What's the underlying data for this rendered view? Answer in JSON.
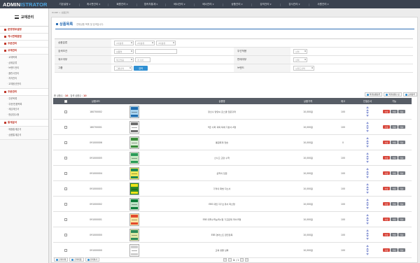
{
  "app": {
    "logo_part1": "ADMIN",
    "logo_part2": "ISTRATOR"
  },
  "top_menu": [
    "기본설정",
    "게시판관리",
    "회원관리",
    "접속자통계",
    "배너관리",
    "배너관리",
    "상품관리",
    "강의관리",
    "강사관리",
    "사원관리"
  ],
  "sidebar": {
    "title": "교재관리",
    "groups": [
      {
        "label": "운영정보설정",
        "items": []
      },
      {
        "label": "게시판제출점",
        "items": []
      },
      {
        "label": "주문관리",
        "items": []
      },
      {
        "label": "교재관리",
        "items": [
          "교재목록",
          "상위분류",
          "브랜드관리",
          "출판사관리",
          "저자관리",
          "교재옵션관리"
        ]
      },
      {
        "label": "주문관리",
        "items": [
          "주문목록",
          "주문/반품목록",
          "세금계산서",
          "현금영수증"
        ]
      },
      {
        "label": "통계분석",
        "items": [
          "매출통계분석",
          "상품통계분석"
        ]
      }
    ]
  },
  "breadcrumb": "HOME > 상품관리",
  "page": {
    "title": "상품목록",
    "description": "전체상품 목록 및 검색입니다."
  },
  "form": {
    "category_label": "상품분류",
    "category_selects": [
      "1차분류",
      "2차분류",
      "3차분류"
    ],
    "search_label": "검색조건",
    "search_select": "상품명",
    "sort_label": "우선적용",
    "sort_select": "선택",
    "display_label": "재고여부",
    "display_select": "재고있음",
    "display_input": "개 이하",
    "sale_label": "판매여부",
    "sale_select": "선택",
    "group_label": "그룹",
    "group_select": "그룹선택",
    "search_button": "검색",
    "brand_label": "브랜드",
    "brand_select": "브랜드선택"
  },
  "list": {
    "total_label": "총 상품수 :",
    "total_value": "10",
    "search_label": ", 검색 상품수 :",
    "search_value": "10",
    "tools": [
      "엑셀상품등록",
      "엑셀상품수정",
      "교재등록"
    ]
  },
  "table": {
    "headers": [
      "상품코드",
      "상품명",
      "상품가격",
      "재고",
      "진열순서",
      "기능"
    ],
    "actions": [
      "수정",
      "삭제",
      "복사"
    ],
    "rows": [
      {
        "code": "180700002",
        "name": "정선수 영양씨 로스쿨 입문강좌",
        "price": "10,000원",
        "stock": "100",
        "colors": [
          "#1f6cae",
          "#a7d3ef"
        ]
      },
      {
        "code": "180700001",
        "name": "9급 사회 과목 독해 기본서 A형",
        "price": "10,000원",
        "stock": "100",
        "colors": [
          "#6e6e6e",
          "#ffffff"
        ]
      },
      {
        "code": "091000006",
        "name": "통합회계 연습",
        "price": "10,000원",
        "stock": "0",
        "colors": [
          "#3a8c3a",
          "#d8ecd4"
        ]
      },
      {
        "code": "091000005",
        "name": "신사고 교양 수학",
        "price": "10,000원",
        "stock": "100",
        "colors": [
          "#2a9a58",
          "#c6e9c2"
        ]
      },
      {
        "code": "091000004",
        "name": "공학의 입문",
        "price": "10,000원",
        "stock": "100",
        "colors": [
          "#1d8a55",
          "#f2e95a"
        ]
      },
      {
        "code": "091000003",
        "name": "기적의 화법 자소서",
        "price": "10,000원",
        "stock": "100",
        "colors": [
          "#f0e21a",
          "#2b8a2b"
        ]
      },
      {
        "code": "091000002",
        "name": "EBS 대입 자기소개서 최신형",
        "price": "10,000원",
        "stock": "100",
        "colors": [
          "#0e7d3a",
          "#bde3c6"
        ]
      },
      {
        "code": "091000001",
        "name": "EBS 대학수학능력시험 기출문제 국어 B형",
        "price": "10,000원",
        "stock": "100",
        "colors": [
          "#e24a2e",
          "#fbe3a1"
        ]
      },
      {
        "code": "091000000",
        "name": "EBS 영어노트 완전정복",
        "price": "10,000원",
        "stock": "100",
        "colors": [
          "#2c8b5a",
          "#dfe9a6"
        ]
      },
      {
        "code": "091000000",
        "name": "교육 생물 심화",
        "price": "10,000원",
        "stock": "100",
        "colors": [
          "#cfcfcf",
          "#ffffff"
        ]
      }
    ]
  },
  "bottom_buttons": [
    "선택삭제",
    "선택이동",
    "선택복사"
  ],
  "pager": {
    "current": "1",
    "total": "/ 1"
  }
}
